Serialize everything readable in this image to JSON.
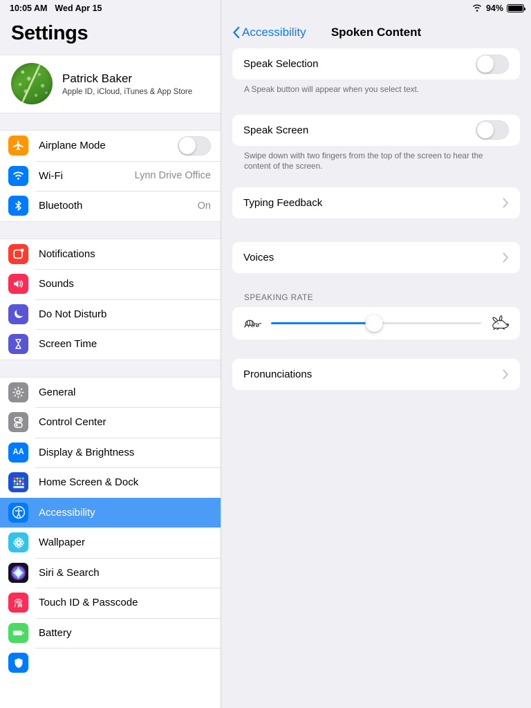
{
  "status_bar": {
    "time": "10:05 AM",
    "date": "Wed Apr 15",
    "wifi_icon": "wifi-icon",
    "battery_percent": "94%",
    "battery_icon": "battery-full-icon"
  },
  "sidebar": {
    "title": "Settings",
    "profile": {
      "name": "Patrick Baker",
      "subtitle": "Apple ID, iCloud, iTunes & App Store",
      "avatar_icon": "leaf-avatar"
    },
    "groups": [
      {
        "items": [
          {
            "label": "Airplane Mode",
            "icon": "airplane-icon",
            "icon_color": "#ff9500",
            "control": "toggle",
            "toggle_on": false
          },
          {
            "label": "Wi-Fi",
            "icon": "wifi-icon",
            "icon_color": "#007aff",
            "value": "Lynn Drive Office"
          },
          {
            "label": "Bluetooth",
            "icon": "bluetooth-icon",
            "icon_color": "#007aff",
            "value": "On"
          }
        ]
      },
      {
        "items": [
          {
            "label": "Notifications",
            "icon": "notifications-icon",
            "icon_color": "#ff3b30"
          },
          {
            "label": "Sounds",
            "icon": "sounds-icon",
            "icon_color": "#fc2d55"
          },
          {
            "label": "Do Not Disturb",
            "icon": "moon-icon",
            "icon_color": "#5856d6"
          },
          {
            "label": "Screen Time",
            "icon": "hourglass-icon",
            "icon_color": "#5856d6"
          }
        ]
      },
      {
        "items": [
          {
            "label": "General",
            "icon": "gear-icon",
            "icon_color": "#8e8e93"
          },
          {
            "label": "Control Center",
            "icon": "control-center-icon",
            "icon_color": "#8e8e93"
          },
          {
            "label": "Display & Brightness",
            "icon": "display-brightness-icon",
            "icon_color": "#007aff"
          },
          {
            "label": "Home Screen & Dock",
            "icon": "home-screen-dock-icon",
            "icon_color": "#1c4ed8"
          },
          {
            "label": "Accessibility",
            "icon": "accessibility-icon",
            "icon_color": "#007aff",
            "selected": true
          },
          {
            "label": "Wallpaper",
            "icon": "wallpaper-icon",
            "icon_color": "#34c3e8"
          },
          {
            "label": "Siri & Search",
            "icon": "siri-icon",
            "icon_color": "#1b1b2b"
          },
          {
            "label": "Touch ID & Passcode",
            "icon": "touch-id-icon",
            "icon_color": "#fc2d55"
          },
          {
            "label": "Battery",
            "icon": "battery-icon",
            "icon_color": "#4cd964"
          }
        ]
      }
    ]
  },
  "main": {
    "back_label": "Accessibility",
    "title": "Spoken Content",
    "speak_selection": {
      "label": "Speak Selection",
      "toggle_on": false,
      "footnote": "A Speak button will appear when you select text."
    },
    "speak_screen": {
      "label": "Speak Screen",
      "toggle_on": false,
      "footnote": "Swipe down with two fingers from the top of the screen to hear the content of the screen."
    },
    "typing_feedback": {
      "label": "Typing Feedback"
    },
    "voices": {
      "label": "Voices"
    },
    "speaking_rate": {
      "header": "SPEAKING RATE",
      "slow_icon": "tortoise-icon",
      "fast_icon": "hare-icon",
      "value_percent": 49
    },
    "pronunciations": {
      "label": "Pronunciations"
    }
  },
  "colors": {
    "accent": "#0a7cff",
    "selected_row": "#4a9cf6",
    "panel_bg": "#f0f0f4"
  }
}
